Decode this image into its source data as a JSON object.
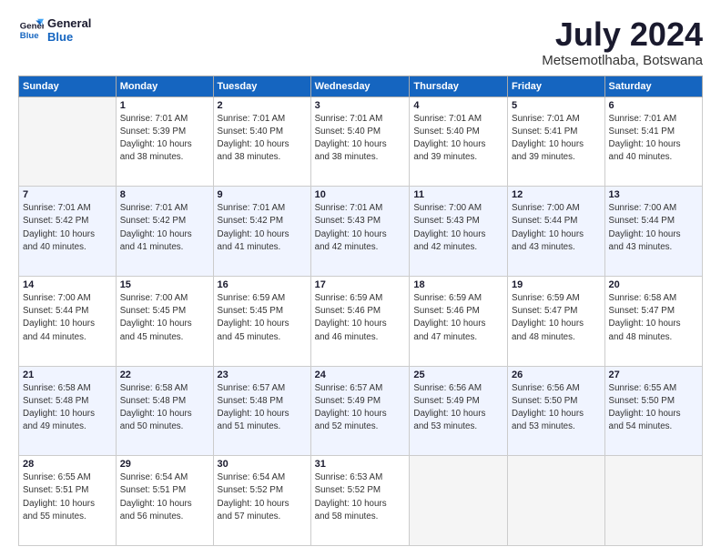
{
  "header": {
    "logo_line1": "General",
    "logo_line2": "Blue",
    "title": "July 2024",
    "subtitle": "Metsemotlhaba, Botswana"
  },
  "columns": [
    "Sunday",
    "Monday",
    "Tuesday",
    "Wednesday",
    "Thursday",
    "Friday",
    "Saturday"
  ],
  "weeks": [
    [
      {
        "day": "",
        "detail": ""
      },
      {
        "day": "1",
        "detail": "Sunrise: 7:01 AM\nSunset: 5:39 PM\nDaylight: 10 hours\nand 38 minutes."
      },
      {
        "day": "2",
        "detail": "Sunrise: 7:01 AM\nSunset: 5:40 PM\nDaylight: 10 hours\nand 38 minutes."
      },
      {
        "day": "3",
        "detail": "Sunrise: 7:01 AM\nSunset: 5:40 PM\nDaylight: 10 hours\nand 38 minutes."
      },
      {
        "day": "4",
        "detail": "Sunrise: 7:01 AM\nSunset: 5:40 PM\nDaylight: 10 hours\nand 39 minutes."
      },
      {
        "day": "5",
        "detail": "Sunrise: 7:01 AM\nSunset: 5:41 PM\nDaylight: 10 hours\nand 39 minutes."
      },
      {
        "day": "6",
        "detail": "Sunrise: 7:01 AM\nSunset: 5:41 PM\nDaylight: 10 hours\nand 40 minutes."
      }
    ],
    [
      {
        "day": "7",
        "detail": "Sunrise: 7:01 AM\nSunset: 5:42 PM\nDaylight: 10 hours\nand 40 minutes."
      },
      {
        "day": "8",
        "detail": "Sunrise: 7:01 AM\nSunset: 5:42 PM\nDaylight: 10 hours\nand 41 minutes."
      },
      {
        "day": "9",
        "detail": "Sunrise: 7:01 AM\nSunset: 5:42 PM\nDaylight: 10 hours\nand 41 minutes."
      },
      {
        "day": "10",
        "detail": "Sunrise: 7:01 AM\nSunset: 5:43 PM\nDaylight: 10 hours\nand 42 minutes."
      },
      {
        "day": "11",
        "detail": "Sunrise: 7:00 AM\nSunset: 5:43 PM\nDaylight: 10 hours\nand 42 minutes."
      },
      {
        "day": "12",
        "detail": "Sunrise: 7:00 AM\nSunset: 5:44 PM\nDaylight: 10 hours\nand 43 minutes."
      },
      {
        "day": "13",
        "detail": "Sunrise: 7:00 AM\nSunset: 5:44 PM\nDaylight: 10 hours\nand 43 minutes."
      }
    ],
    [
      {
        "day": "14",
        "detail": "Sunrise: 7:00 AM\nSunset: 5:44 PM\nDaylight: 10 hours\nand 44 minutes."
      },
      {
        "day": "15",
        "detail": "Sunrise: 7:00 AM\nSunset: 5:45 PM\nDaylight: 10 hours\nand 45 minutes."
      },
      {
        "day": "16",
        "detail": "Sunrise: 6:59 AM\nSunset: 5:45 PM\nDaylight: 10 hours\nand 45 minutes."
      },
      {
        "day": "17",
        "detail": "Sunrise: 6:59 AM\nSunset: 5:46 PM\nDaylight: 10 hours\nand 46 minutes."
      },
      {
        "day": "18",
        "detail": "Sunrise: 6:59 AM\nSunset: 5:46 PM\nDaylight: 10 hours\nand 47 minutes."
      },
      {
        "day": "19",
        "detail": "Sunrise: 6:59 AM\nSunset: 5:47 PM\nDaylight: 10 hours\nand 48 minutes."
      },
      {
        "day": "20",
        "detail": "Sunrise: 6:58 AM\nSunset: 5:47 PM\nDaylight: 10 hours\nand 48 minutes."
      }
    ],
    [
      {
        "day": "21",
        "detail": "Sunrise: 6:58 AM\nSunset: 5:48 PM\nDaylight: 10 hours\nand 49 minutes."
      },
      {
        "day": "22",
        "detail": "Sunrise: 6:58 AM\nSunset: 5:48 PM\nDaylight: 10 hours\nand 50 minutes."
      },
      {
        "day": "23",
        "detail": "Sunrise: 6:57 AM\nSunset: 5:48 PM\nDaylight: 10 hours\nand 51 minutes."
      },
      {
        "day": "24",
        "detail": "Sunrise: 6:57 AM\nSunset: 5:49 PM\nDaylight: 10 hours\nand 52 minutes."
      },
      {
        "day": "25",
        "detail": "Sunrise: 6:56 AM\nSunset: 5:49 PM\nDaylight: 10 hours\nand 53 minutes."
      },
      {
        "day": "26",
        "detail": "Sunrise: 6:56 AM\nSunset: 5:50 PM\nDaylight: 10 hours\nand 53 minutes."
      },
      {
        "day": "27",
        "detail": "Sunrise: 6:55 AM\nSunset: 5:50 PM\nDaylight: 10 hours\nand 54 minutes."
      }
    ],
    [
      {
        "day": "28",
        "detail": "Sunrise: 6:55 AM\nSunset: 5:51 PM\nDaylight: 10 hours\nand 55 minutes."
      },
      {
        "day": "29",
        "detail": "Sunrise: 6:54 AM\nSunset: 5:51 PM\nDaylight: 10 hours\nand 56 minutes."
      },
      {
        "day": "30",
        "detail": "Sunrise: 6:54 AM\nSunset: 5:52 PM\nDaylight: 10 hours\nand 57 minutes."
      },
      {
        "day": "31",
        "detail": "Sunrise: 6:53 AM\nSunset: 5:52 PM\nDaylight: 10 hours\nand 58 minutes."
      },
      {
        "day": "",
        "detail": ""
      },
      {
        "day": "",
        "detail": ""
      },
      {
        "day": "",
        "detail": ""
      }
    ]
  ]
}
